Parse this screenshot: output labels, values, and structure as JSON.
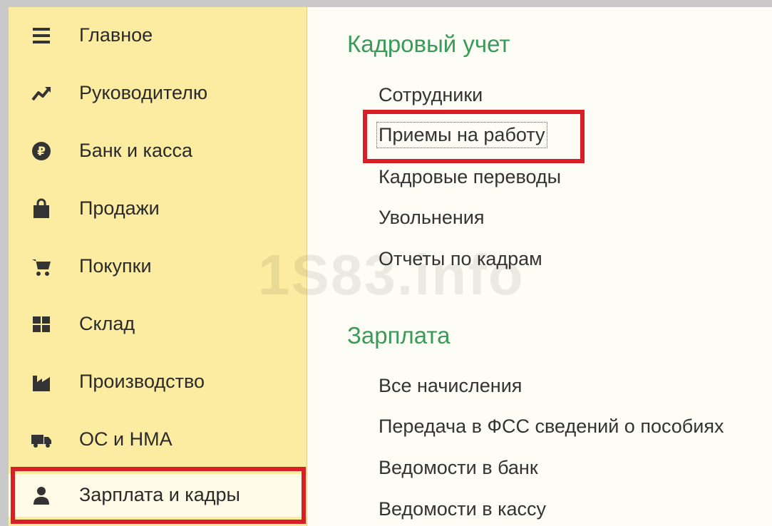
{
  "sidebar": {
    "items": [
      {
        "label": "Главное",
        "icon": "menu-lines-icon"
      },
      {
        "label": "Руководителю",
        "icon": "trend-chart-icon"
      },
      {
        "label": "Банк и касса",
        "icon": "ruble-coin-icon"
      },
      {
        "label": "Продажи",
        "icon": "shopping-bag-icon"
      },
      {
        "label": "Покупки",
        "icon": "cart-icon"
      },
      {
        "label": "Склад",
        "icon": "warehouse-grid-icon"
      },
      {
        "label": "Производство",
        "icon": "factory-icon"
      },
      {
        "label": "ОС и НМА",
        "icon": "truck-icon"
      },
      {
        "label": "Зарплата и кадры",
        "icon": "person-icon"
      }
    ],
    "active_index": 8
  },
  "content": {
    "sections": [
      {
        "title": "Кадровый учет",
        "links": [
          "Сотрудники",
          "Приемы на работу",
          "Кадровые переводы",
          "Увольнения",
          "Отчеты по кадрам"
        ]
      },
      {
        "title": "Зарплата",
        "links": [
          "Все начисления",
          "Передача в ФСС сведений о пособиях",
          "Ведомости в банк",
          "Ведомости в кассу"
        ]
      }
    ]
  },
  "watermark": "1S83.info",
  "colors": {
    "sidebar_bg": "#fbeca1",
    "highlight": "#d91f26",
    "section_title": "#3a9a5a"
  }
}
